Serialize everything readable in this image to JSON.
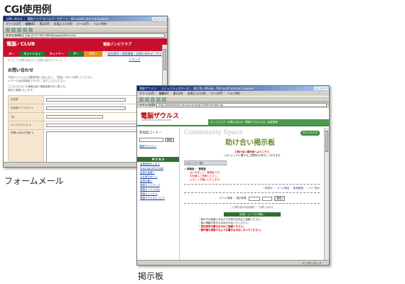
{
  "page": {
    "title": "CGI使用例",
    "caption_form": "フォームメール",
    "caption_board": "掲示板"
  },
  "form_window": {
    "title": "お問い合わせ ： 電脳クラブ のヘルプ・サポート - Microsoft Internet Explorer",
    "menu": [
      "ファイル(F)",
      "編集(E)",
      "表示(V)",
      "お気に入り(A)",
      "ツール(T)",
      "ヘルプ(H)"
    ],
    "address_label": "アドレス(D)",
    "address": "http://1.37.190.166:80/support/form.htm",
    "logo": "電脳✓CLUB",
    "logo_right": "電脳ゾンビクラブ",
    "nav": [
      {
        "label": "ホーム",
        "color": "#c8102e"
      },
      {
        "label": "ネットショップ",
        "color": "#1f7a3a"
      },
      {
        "label": "ネットワーク",
        "color": "#c8102e"
      },
      {
        "label": "ゲーム",
        "color": "#1f7a3a"
      },
      {
        "label": "サポート",
        "color": "#e8901a"
      }
    ],
    "nav_links": "会社案内｜採用情報｜お問い合わせ｜サイトマップ",
    "breadcrumb": "ホーム > お問い合わせ > お問い合わせフォーム",
    "heading": "お問い合わせ",
    "intro": [
      "下記のフォームに必要事項をご記入の上、「送信」ボタンを押してください。",
      "＊マークは必須項目ですので、必ずご入力ください。"
    ],
    "intro2": [
      "ご入力いただいた情報は個人情報保護方針に基づき、",
      "適切に管理いたします。"
    ],
    "fields": [
      {
        "label": "お名前"
      },
      {
        "label": "お名前(フリガナ) ＊"
      },
      {
        "label": "TEL"
      },
      {
        "label": "メールアドレス ＊"
      },
      {
        "label": "お問い合わせ内容 ＊"
      }
    ]
  },
  "board_window": {
    "title": "電脳ザウルス ： コミュニティスペース ： 助け合い掲示板 - Microsoft Internet Explorer",
    "menu": [
      "ファイル(F)",
      "編集(E)",
      "表示(V)",
      "お気に入り(A)",
      "ツール(T)",
      "ヘルプ(H)"
    ],
    "address_label": "アドレス(D)",
    "address": "http://www.denno-zaurus.com/cgi-bin/forum/bbs.cgi",
    "logo": "電脳ザウルス",
    "logo_sub": "www.denno-zaurus.com",
    "navstrip": "サイトマップ｜お問い合わせ｜電脳ザウルスとは｜会員登録",
    "search_label": "検索",
    "search_button": "検索",
    "side_link": "電脳ザウルスシ",
    "section_title": "参加型コーナー",
    "menu_header": "M E N U",
    "menu_items": [
      "会員登録をします",
      "Dancing with Code",
      "会員の皆様へ",
      "お仕事サポート",
      "会員の集い",
      "電脳サイトマップ",
      "電脳サーバーIcon",
      "電脳オリジナル",
      "電脳ザウルスについて"
    ],
    "community_label": "Community Space",
    "board_title": "助け合い掲示板",
    "board_help_button": "書き込み方法",
    "intro_line": "【 助け合い掲示板へようこそ 】",
    "sub_line": "このトピックに関するご質問をお待ちしております",
    "thread_bar": "[スレッド一覧]",
    "post_title": "◇ 投稿者 ： 管理者",
    "post_lines": [
      "はじめまして、管理者です。",
      "お気軽にご質問ください。",
      "よろしくお願いいたします。"
    ],
    "links_line": "一覧表示 ・ メール発送 ・ 新規投稿 ・ ツリー表示",
    "search_area_label": "ページ 検索 ・ 表示件数",
    "search_go": "表示",
    "footer_note": "この掲示板の利用規約 ／ お問い合わせ",
    "rules_header": "投稿についてのお願い",
    "rules": [
      "・他の方の迷惑となるような書き込みはご遠慮ください。",
      "・個人情報の書き込みは行わないでください。",
      "・営利目的の書き込みはご遠慮ください。",
      "・著作権を侵害するような書き込みはしないでください。"
    ],
    "status": "インターネット"
  }
}
